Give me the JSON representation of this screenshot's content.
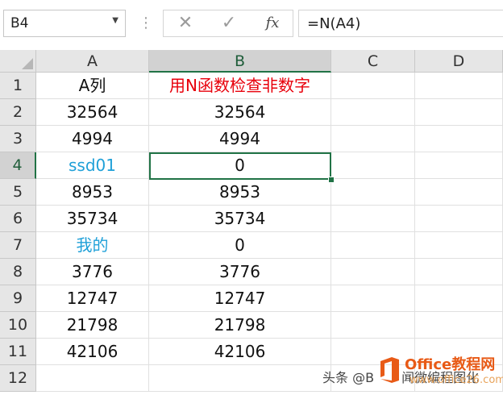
{
  "formula_bar": {
    "name_box": "B4",
    "cancel_icon": "close-icon",
    "enter_icon": "check-icon",
    "function_label": "fx",
    "formula": "=N(A4)"
  },
  "columns": [
    "A",
    "B",
    "C",
    "D"
  ],
  "selected_column": "B",
  "rows": [
    {
      "num": "1",
      "a": "A列",
      "b": "用N函数检查非数字",
      "a_style": "normal",
      "b_style": "red"
    },
    {
      "num": "2",
      "a": "32564",
      "b": "32564",
      "a_style": "normal",
      "b_style": "normal"
    },
    {
      "num": "3",
      "a": "4994",
      "b": "4994",
      "a_style": "normal",
      "b_style": "normal"
    },
    {
      "num": "4",
      "a": "ssd01",
      "b": "0",
      "a_style": "blue",
      "b_style": "normal"
    },
    {
      "num": "5",
      "a": "8953",
      "b": "8953",
      "a_style": "normal",
      "b_style": "normal"
    },
    {
      "num": "6",
      "a": "35734",
      "b": "35734",
      "a_style": "normal",
      "b_style": "normal"
    },
    {
      "num": "7",
      "a": "我的",
      "b": "0",
      "a_style": "blue",
      "b_style": "normal"
    },
    {
      "num": "8",
      "a": "3776",
      "b": "3776",
      "a_style": "normal",
      "b_style": "normal"
    },
    {
      "num": "9",
      "a": "12747",
      "b": "12747",
      "a_style": "normal",
      "b_style": "normal"
    },
    {
      "num": "10",
      "a": "21798",
      "b": "21798",
      "a_style": "normal",
      "b_style": "normal"
    },
    {
      "num": "11",
      "a": "42106",
      "b": "42106",
      "a_style": "normal",
      "b_style": "normal"
    },
    {
      "num": "12",
      "a": "",
      "b": "",
      "a_style": "normal",
      "b_style": "normal"
    }
  ],
  "selected_row": "4",
  "watermark": {
    "text": "头条 @B",
    "text2": "闻微编程图化",
    "logo_name": "Office教程网",
    "logo_url": "www.office26.com"
  },
  "colors": {
    "accent": "#217346",
    "header_red": "#e8000b",
    "text_blue": "#1fa0d8",
    "logo_orange": "#e85a16"
  }
}
